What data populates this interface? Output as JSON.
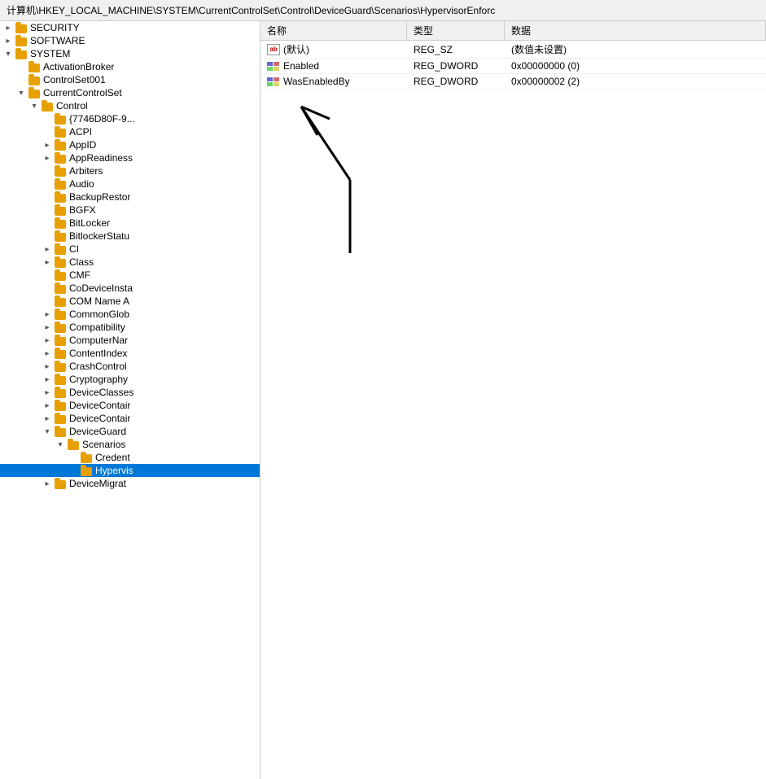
{
  "addressBar": {
    "path": "计算机\\HKEY_LOCAL_MACHINE\\SYSTEM\\CurrentControlSet\\Control\\DeviceGuard\\Scenarios\\HypervisorEnforc"
  },
  "treePane": {
    "items": [
      {
        "id": "security",
        "label": "SECURITY",
        "indent": 1,
        "expanded": false,
        "hasArrow": true,
        "arrowDir": "right"
      },
      {
        "id": "software",
        "label": "SOFTWARE",
        "indent": 1,
        "expanded": false,
        "hasArrow": true,
        "arrowDir": "right"
      },
      {
        "id": "system",
        "label": "SYSTEM",
        "indent": 1,
        "expanded": true,
        "hasArrow": true,
        "arrowDir": "down"
      },
      {
        "id": "activationbroker",
        "label": "ActivationBroker",
        "indent": 2,
        "expanded": false,
        "hasArrow": false
      },
      {
        "id": "controlset001",
        "label": "ControlSet001",
        "indent": 2,
        "expanded": false,
        "hasArrow": false
      },
      {
        "id": "currentcontrolset",
        "label": "CurrentControlSet",
        "indent": 2,
        "expanded": true,
        "hasArrow": true,
        "arrowDir": "down"
      },
      {
        "id": "control",
        "label": "Control",
        "indent": 3,
        "expanded": true,
        "hasArrow": true,
        "arrowDir": "down"
      },
      {
        "id": "7746d80f",
        "label": "{7746D80F-9...",
        "indent": 4,
        "expanded": false,
        "hasArrow": false
      },
      {
        "id": "acpi",
        "label": "ACPI",
        "indent": 4,
        "expanded": false,
        "hasArrow": false
      },
      {
        "id": "appid",
        "label": "AppID",
        "indent": 4,
        "expanded": false,
        "hasArrow": true,
        "arrowDir": "right"
      },
      {
        "id": "appreadiness",
        "label": "AppReadiness",
        "indent": 4,
        "expanded": false,
        "hasArrow": true,
        "arrowDir": "right"
      },
      {
        "id": "arbiters",
        "label": "Arbiters",
        "indent": 4,
        "expanded": false,
        "hasArrow": false
      },
      {
        "id": "audio",
        "label": "Audio",
        "indent": 4,
        "expanded": false,
        "hasArrow": false
      },
      {
        "id": "backuprestore",
        "label": "BackupRestor",
        "indent": 4,
        "expanded": false,
        "hasArrow": false
      },
      {
        "id": "bgfx",
        "label": "BGFX",
        "indent": 4,
        "expanded": false,
        "hasArrow": false
      },
      {
        "id": "bitlocker",
        "label": "BitLocker",
        "indent": 4,
        "expanded": false,
        "hasArrow": false
      },
      {
        "id": "bitlockerstatus",
        "label": "BitlockerStatu",
        "indent": 4,
        "expanded": false,
        "hasArrow": false
      },
      {
        "id": "ci",
        "label": "CI",
        "indent": 4,
        "expanded": false,
        "hasArrow": true,
        "arrowDir": "right"
      },
      {
        "id": "class",
        "label": "Class",
        "indent": 4,
        "expanded": false,
        "hasArrow": true,
        "arrowDir": "right"
      },
      {
        "id": "cmf",
        "label": "CMF",
        "indent": 4,
        "expanded": false,
        "hasArrow": false
      },
      {
        "id": "codeviceinst",
        "label": "CoDeviceInsta",
        "indent": 4,
        "expanded": false,
        "hasArrow": false
      },
      {
        "id": "comname",
        "label": "COM Name A",
        "indent": 4,
        "expanded": false,
        "hasArrow": false
      },
      {
        "id": "commonglob",
        "label": "CommonGlob",
        "indent": 4,
        "expanded": false,
        "hasArrow": true,
        "arrowDir": "right"
      },
      {
        "id": "compatibility",
        "label": "Compatibility",
        "indent": 4,
        "expanded": false,
        "hasArrow": true,
        "arrowDir": "right"
      },
      {
        "id": "computername",
        "label": "ComputerNar",
        "indent": 4,
        "expanded": false,
        "hasArrow": true,
        "arrowDir": "right"
      },
      {
        "id": "contentindex",
        "label": "ContentIndex",
        "indent": 4,
        "expanded": false,
        "hasArrow": true,
        "arrowDir": "right"
      },
      {
        "id": "crashcontrol",
        "label": "CrashControl",
        "indent": 4,
        "expanded": false,
        "hasArrow": true,
        "arrowDir": "right"
      },
      {
        "id": "cryptography",
        "label": "Cryptography",
        "indent": 4,
        "expanded": false,
        "hasArrow": true,
        "arrowDir": "right"
      },
      {
        "id": "deviceclasses",
        "label": "DeviceClasses",
        "indent": 4,
        "expanded": false,
        "hasArrow": true,
        "arrowDir": "right"
      },
      {
        "id": "devicecontain1",
        "label": "DeviceContair",
        "indent": 4,
        "expanded": false,
        "hasArrow": true,
        "arrowDir": "right"
      },
      {
        "id": "devicecontain2",
        "label": "DeviceContair",
        "indent": 4,
        "expanded": false,
        "hasArrow": true,
        "arrowDir": "right"
      },
      {
        "id": "deviceguard",
        "label": "DeviceGuard",
        "indent": 4,
        "expanded": true,
        "hasArrow": true,
        "arrowDir": "down"
      },
      {
        "id": "scenarios",
        "label": "Scenarios",
        "indent": 5,
        "expanded": true,
        "hasArrow": true,
        "arrowDir": "down"
      },
      {
        "id": "credent",
        "label": "Credent",
        "indent": 6,
        "expanded": false,
        "hasArrow": false
      },
      {
        "id": "hypervis",
        "label": "Hypervis",
        "indent": 6,
        "expanded": false,
        "hasArrow": false,
        "selected": true
      },
      {
        "id": "devicemigrat",
        "label": "DeviceMigrat",
        "indent": 4,
        "expanded": false,
        "hasArrow": true,
        "arrowDir": "right"
      }
    ]
  },
  "registryTable": {
    "headers": [
      "名称",
      "类型",
      "数据"
    ],
    "rows": [
      {
        "icon": "ab",
        "name": "(默认)",
        "type": "REG_SZ",
        "data": "(数值未设置)"
      },
      {
        "icon": "dword",
        "name": "Enabled",
        "type": "REG_DWORD",
        "data": "0x00000000 (0)"
      },
      {
        "icon": "dword",
        "name": "WasEnabledBy",
        "type": "REG_DWORD",
        "data": "0x00000002 (2)"
      }
    ]
  },
  "colors": {
    "folder": "#e8a000",
    "folderLight": "#f5c842",
    "selected": "#0078d7",
    "hover": "#cce8ff",
    "headerBg": "#f0f0f0"
  }
}
